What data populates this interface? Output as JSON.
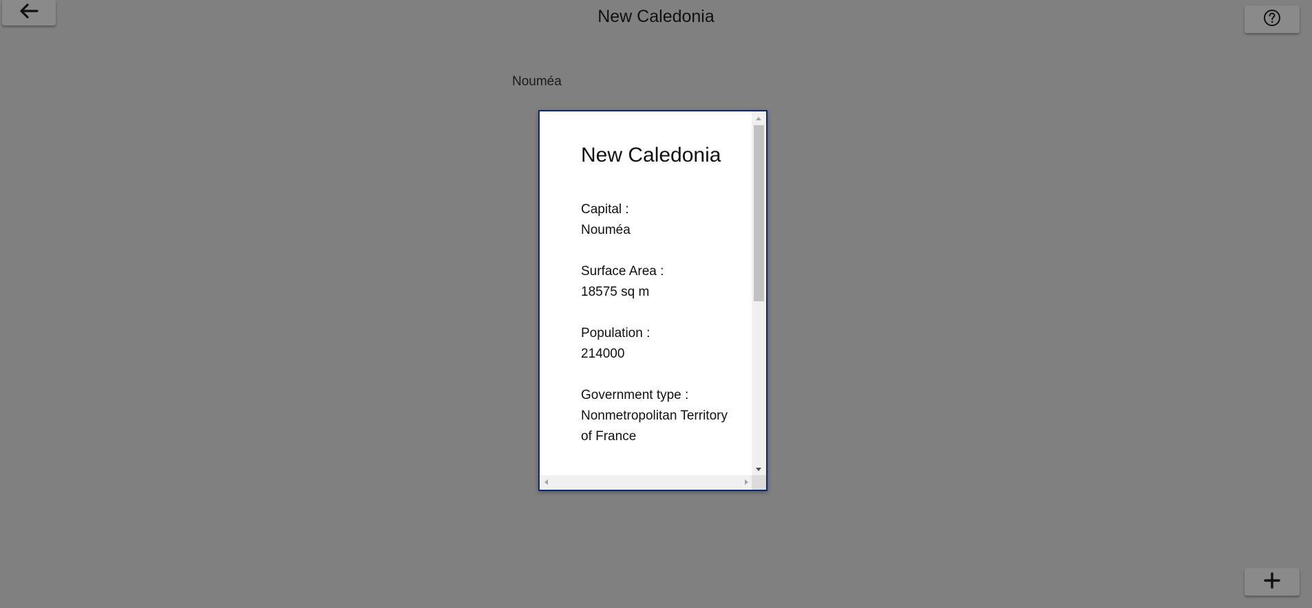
{
  "header": {
    "title": "New Caledonia",
    "back_icon": "arrow-left-icon",
    "help_icon": "question-circle-icon"
  },
  "capital_label": "Nouméa",
  "card": {
    "title": "New Caledonia",
    "fields": [
      {
        "label": "Capital :",
        "value": "Nouméa"
      },
      {
        "label": "Surface Area :",
        "value": "18575 sq m"
      },
      {
        "label": "Population :",
        "value": "214000"
      },
      {
        "label": "Government type :",
        "value": "Nonmetropolitan Territory of France"
      }
    ]
  },
  "fab": {
    "icon": "plus-icon"
  },
  "colors": {
    "background": "#808080",
    "card_border": "#0b2a6b",
    "button": "#8a8a8a"
  }
}
